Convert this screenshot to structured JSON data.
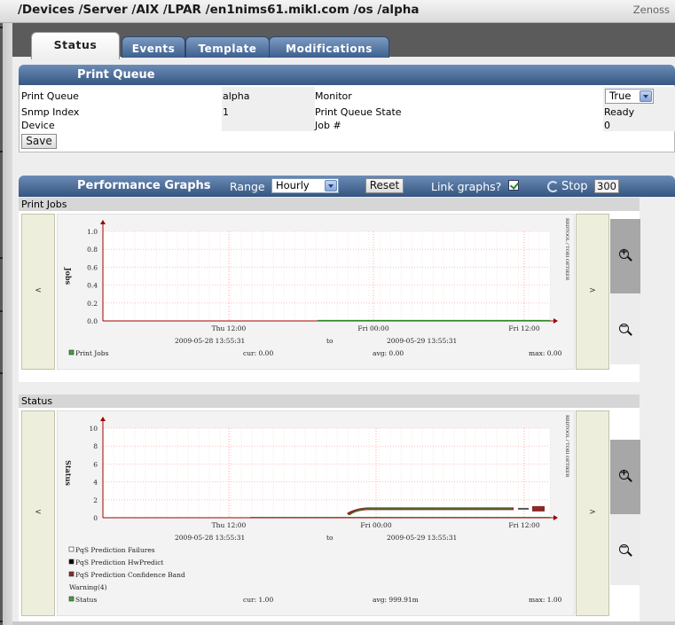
{
  "breadcrumb": {
    "path": "/Devices /Server /AIX /LPAR /en1nims61.mikl.com /os /alpha",
    "brand": "Zenoss"
  },
  "tabs": [
    {
      "label": "Status",
      "active": true
    },
    {
      "label": "Events"
    },
    {
      "label": "Template"
    },
    {
      "label": "Modifications"
    }
  ],
  "print_queue": {
    "title": "Print Queue",
    "fields": {
      "print_queue_label": "Print Queue",
      "print_queue_value": "alpha",
      "snmp_index_label": "Snmp Index",
      "snmp_index_value": "1",
      "device_label": "Device",
      "device_value": "",
      "monitor_label": "Monitor",
      "monitor_value": "True",
      "state_label": "Print Queue State",
      "state_value": "Ready",
      "job_label": "Job #",
      "job_value": "0"
    },
    "save_label": "Save"
  },
  "perf": {
    "title": "Performance Graphs",
    "range_label": "Range",
    "range_value": "Hourly",
    "reset_label": "Reset",
    "link_label": "Link graphs?",
    "link_checked": true,
    "stop_label": "Stop",
    "refresh_value": "300"
  },
  "graphs": [
    {
      "section": "Print Jobs",
      "nav_prev": "<",
      "nav_next": ">",
      "ylabel": "Jobs",
      "yticks": [
        "1.0",
        "0.8",
        "0.6",
        "0.4",
        "0.2",
        "0.0"
      ],
      "xticks": [
        "Thu 12:00",
        "Fri 00:00",
        "Fri 12:00"
      ],
      "start": "2009-05-28 13:55:31",
      "to": "to",
      "end": "2009-05-29 13:55:31",
      "side_text": "RRDTOOL / TOBI OETIKER",
      "legend": [
        {
          "label": "Print Jobs",
          "color": "#40a040"
        }
      ],
      "stats": {
        "cur": "cur: 0.00",
        "avg": "avg: 0.00",
        "max": "max: 0.00"
      }
    },
    {
      "section": "Status",
      "nav_prev": "<",
      "nav_next": ">",
      "ylabel": "Status",
      "yticks": [
        "10",
        "8",
        "6",
        "4",
        "2",
        "0"
      ],
      "xticks": [
        "Thu 12:00",
        "Fri 00:00",
        "Fri 12:00"
      ],
      "start": "2009-05-28 13:55:31",
      "to": "to",
      "end": "2009-05-29 13:55:31",
      "side_text": "RRDTOOL / TOBI OETIKER",
      "legend": [
        {
          "label": "PqS Prediction Failures",
          "color": "#ffffff"
        },
        {
          "label": "PqS Prediction HwPredict",
          "color": "#000000"
        },
        {
          "label": "PqS Prediction Confidence Band",
          "color": "#8b2a2a"
        },
        {
          "label": "Warning(4)",
          "color": ""
        },
        {
          "label": "Status",
          "color": "#40a040"
        }
      ],
      "stats": {
        "cur": "cur: 1.00",
        "avg": "avg: 999.91m",
        "max": "max: 1.00"
      }
    }
  ],
  "colors": {
    "accent": "#3d5f8e",
    "grid": "#ff9c9c",
    "axis": "#a00000"
  }
}
